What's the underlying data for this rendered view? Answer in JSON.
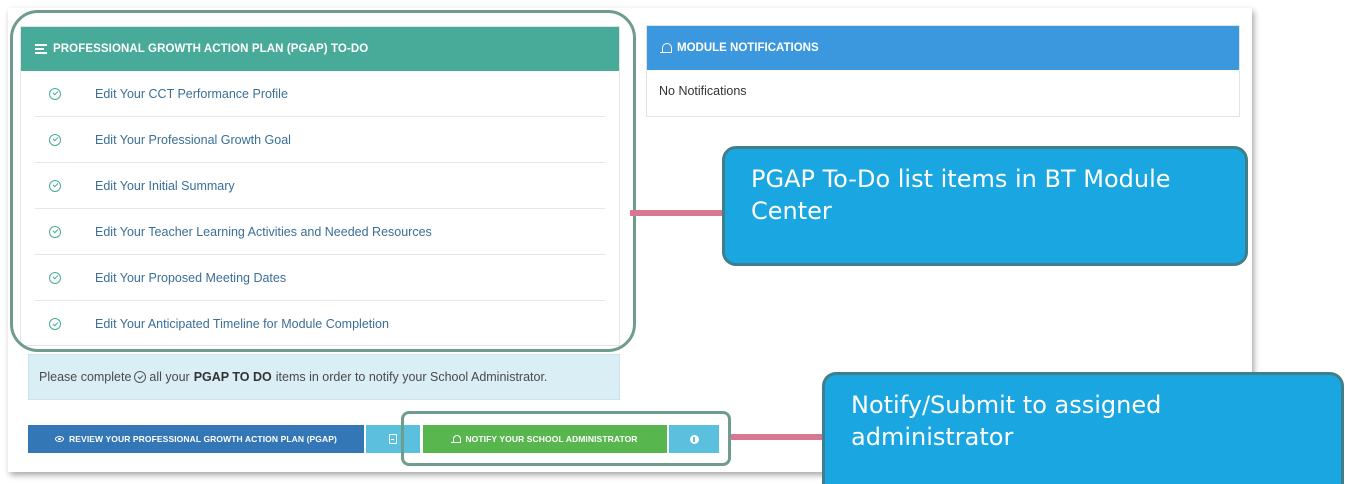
{
  "pgap": {
    "header": "PROFESSIONAL GROWTH ACTION PLAN (PGAP) TO-DO",
    "items": [
      "Edit Your CCT Performance Profile",
      "Edit Your Professional Growth Goal",
      "Edit Your Initial Summary",
      "Edit Your Teacher Learning Activities and Needed Resources",
      "Edit Your Proposed Meeting Dates",
      "Edit Your Anticipated Timeline for Module Completion"
    ]
  },
  "notifications": {
    "header": "MODULE NOTIFICATIONS",
    "body": "No Notifications"
  },
  "info": {
    "prefix": "Please complete",
    "middle": "all your",
    "bold": "PGAP TO DO",
    "suffix": "items in order to notify your School Administrator."
  },
  "buttons": {
    "review": "REVIEW YOUR PROFESSIONAL GROWTH ACTION PLAN (PGAP)",
    "notify": "NOTIFY YOUR SCHOOL ADMINISTRATOR"
  },
  "callouts": {
    "todo": "PGAP To-Do list items in BT Module Center",
    "notify": "Notify/Submit to assigned administrator"
  },
  "colors": {
    "pgap_header": "#48ab99",
    "notif_header": "#3b98df",
    "review_button": "#3477b7",
    "notify_button": "#57b74e",
    "callout": "#1aa6e0",
    "connector": "#d87793"
  }
}
